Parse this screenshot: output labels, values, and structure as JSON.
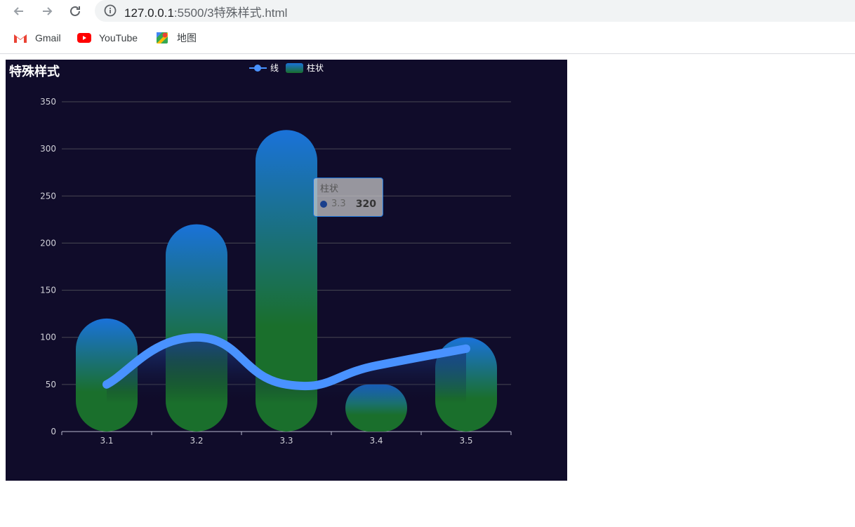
{
  "browser": {
    "url_host": "127.0.0.1",
    "url_rest": ":5500/3特殊样式.html",
    "bookmarks": [
      {
        "label": "Gmail",
        "icon": "gmail-icon"
      },
      {
        "label": "YouTube",
        "icon": "youtube-icon"
      },
      {
        "label": "地图",
        "icon": "maps-icon"
      }
    ]
  },
  "chart": {
    "title": "特殊样式",
    "legend": {
      "line": "线",
      "bar": "柱状"
    },
    "tooltip": {
      "title": "柱状",
      "category": "3.3",
      "value": "320"
    }
  },
  "colors": {
    "background": "#100c2a",
    "bar_top": "#1a72d9",
    "bar_bottom": "#1a6f2c",
    "line": "#4992ff"
  },
  "chart_data": {
    "type": "bar",
    "title": "特殊样式",
    "categories": [
      "3.1",
      "3.2",
      "3.3",
      "3.4",
      "3.5"
    ],
    "series": [
      {
        "name": "柱状",
        "type": "bar",
        "values": [
          120,
          220,
          320,
          50,
          100
        ]
      },
      {
        "name": "线",
        "type": "line",
        "smooth": true,
        "values": [
          50,
          100,
          50,
          70,
          88
        ]
      }
    ],
    "ylim": [
      0,
      350
    ],
    "yticks": [
      0,
      50,
      100,
      150,
      200,
      250,
      300,
      350
    ],
    "grid": true,
    "legend_position": "top-center"
  }
}
